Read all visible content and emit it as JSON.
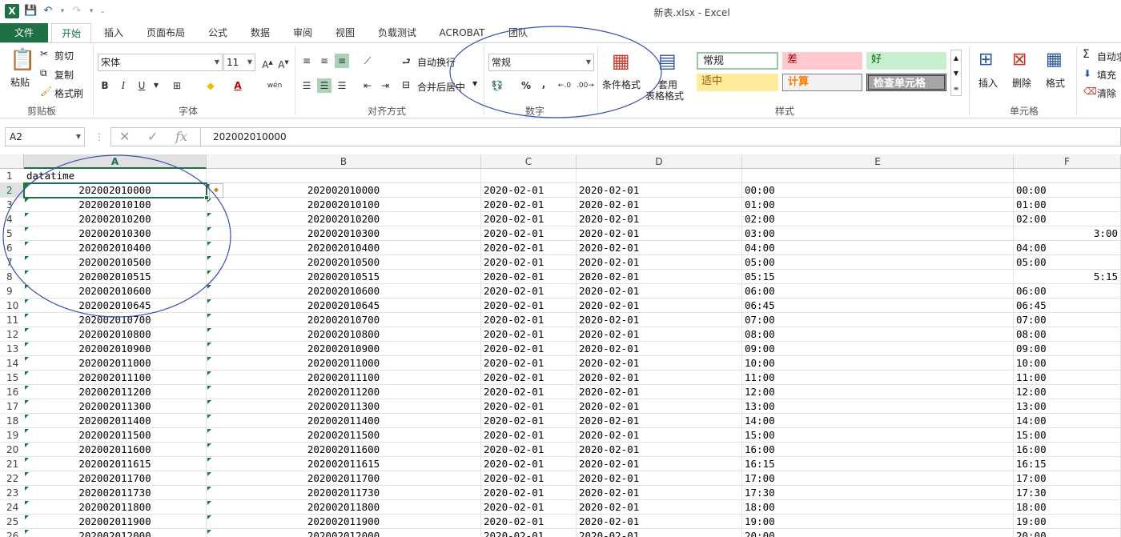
{
  "window": {
    "title": "新表.xlsx - Excel"
  },
  "tabs": [
    {
      "label": "文件"
    },
    {
      "label": "开始"
    },
    {
      "label": "插入"
    },
    {
      "label": "页面布局"
    },
    {
      "label": "公式"
    },
    {
      "label": "数据"
    },
    {
      "label": "审阅"
    },
    {
      "label": "视图"
    },
    {
      "label": "负载测试"
    },
    {
      "label": "ACROBAT"
    },
    {
      "label": "团队"
    }
  ],
  "ribbon": {
    "clipboard": {
      "paste": "粘贴",
      "cut": "剪切",
      "copy": "复制",
      "format_painter": "格式刷",
      "label": "剪贴板"
    },
    "font": {
      "name": "宋体",
      "size": "11",
      "bold": "B",
      "italic": "I",
      "underline": "U",
      "phonetic": "wén",
      "label": "字体"
    },
    "alignment": {
      "wrap": "自动换行",
      "merge": "合并后居中",
      "label": "对齐方式"
    },
    "number": {
      "format": "常规",
      "percent": "%",
      "comma": ",",
      "label": "数字"
    },
    "styles": {
      "conditional": "条件格式",
      "table_line1": "套用",
      "table_line2": "表格格式",
      "label": "样式",
      "cells": [
        {
          "text": "常规",
          "bg": "#ffffff",
          "fg": "#000000"
        },
        {
          "text": "差",
          "bg": "#ffc7ce",
          "fg": "#9c0006"
        },
        {
          "text": "好",
          "bg": "#c6efce",
          "fg": "#006100"
        },
        {
          "text": "适中",
          "bg": "#ffeb9c",
          "fg": "#9c5700"
        },
        {
          "text": "计算",
          "bg": "#f2f2f2",
          "fg": "#fa7d00"
        },
        {
          "text": "检查单元格",
          "bg": "#a5a5a5",
          "fg": "#ffffff"
        }
      ]
    },
    "cells": {
      "insert": "插入",
      "delete": "删除",
      "format": "格式",
      "label": "单元格"
    },
    "editing": {
      "autosum": "自动求",
      "fill": "填充",
      "clear": "清除"
    }
  },
  "formula_bar": {
    "name_box": "A2",
    "value": "202002010000"
  },
  "columns": [
    "A",
    "B",
    "C",
    "D",
    "E",
    "F"
  ],
  "rows": [
    {
      "n": "1",
      "a": "datatime",
      "b": "",
      "c": "",
      "d": "",
      "e": "",
      "f": "",
      "f_right": false
    },
    {
      "n": "2",
      "a": "202002010000",
      "b": "202002010000",
      "c": "2020-02-01",
      "d": "2020-02-01",
      "e": "00:00",
      "f": "00:00",
      "f_right": false
    },
    {
      "n": "3",
      "a": "202002010100",
      "b": "202002010100",
      "c": "2020-02-01",
      "d": "2020-02-01",
      "e": "01:00",
      "f": "01:00",
      "f_right": false
    },
    {
      "n": "4",
      "a": "202002010200",
      "b": "202002010200",
      "c": "2020-02-01",
      "d": "2020-02-01",
      "e": "02:00",
      "f": "02:00",
      "f_right": false
    },
    {
      "n": "5",
      "a": "202002010300",
      "b": "202002010300",
      "c": "2020-02-01",
      "d": "2020-02-01",
      "e": "03:00",
      "f": "3:00",
      "f_right": true
    },
    {
      "n": "6",
      "a": "202002010400",
      "b": "202002010400",
      "c": "2020-02-01",
      "d": "2020-02-01",
      "e": "04:00",
      "f": "04:00",
      "f_right": false
    },
    {
      "n": "7",
      "a": "202002010500",
      "b": "202002010500",
      "c": "2020-02-01",
      "d": "2020-02-01",
      "e": "05:00",
      "f": "05:00",
      "f_right": false
    },
    {
      "n": "8",
      "a": "202002010515",
      "b": "202002010515",
      "c": "2020-02-01",
      "d": "2020-02-01",
      "e": "05:15",
      "f": "5:15",
      "f_right": true
    },
    {
      "n": "9",
      "a": "202002010600",
      "b": "202002010600",
      "c": "2020-02-01",
      "d": "2020-02-01",
      "e": "06:00",
      "f": "06:00",
      "f_right": false
    },
    {
      "n": "10",
      "a": "202002010645",
      "b": "202002010645",
      "c": "2020-02-01",
      "d": "2020-02-01",
      "e": "06:45",
      "f": "06:45",
      "f_right": false
    },
    {
      "n": "11",
      "a": "202002010700",
      "b": "202002010700",
      "c": "2020-02-01",
      "d": "2020-02-01",
      "e": "07:00",
      "f": "07:00",
      "f_right": false
    },
    {
      "n": "12",
      "a": "202002010800",
      "b": "202002010800",
      "c": "2020-02-01",
      "d": "2020-02-01",
      "e": "08:00",
      "f": "08:00",
      "f_right": false
    },
    {
      "n": "13",
      "a": "202002010900",
      "b": "202002010900",
      "c": "2020-02-01",
      "d": "2020-02-01",
      "e": "09:00",
      "f": "09:00",
      "f_right": false
    },
    {
      "n": "14",
      "a": "202002011000",
      "b": "202002011000",
      "c": "2020-02-01",
      "d": "2020-02-01",
      "e": "10:00",
      "f": "10:00",
      "f_right": false
    },
    {
      "n": "15",
      "a": "202002011100",
      "b": "202002011100",
      "c": "2020-02-01",
      "d": "2020-02-01",
      "e": "11:00",
      "f": "11:00",
      "f_right": false
    },
    {
      "n": "16",
      "a": "202002011200",
      "b": "202002011200",
      "c": "2020-02-01",
      "d": "2020-02-01",
      "e": "12:00",
      "f": "12:00",
      "f_right": false
    },
    {
      "n": "17",
      "a": "202002011300",
      "b": "202002011300",
      "c": "2020-02-01",
      "d": "2020-02-01",
      "e": "13:00",
      "f": "13:00",
      "f_right": false
    },
    {
      "n": "18",
      "a": "202002011400",
      "b": "202002011400",
      "c": "2020-02-01",
      "d": "2020-02-01",
      "e": "14:00",
      "f": "14:00",
      "f_right": false
    },
    {
      "n": "19",
      "a": "202002011500",
      "b": "202002011500",
      "c": "2020-02-01",
      "d": "2020-02-01",
      "e": "15:00",
      "f": "15:00",
      "f_right": false
    },
    {
      "n": "20",
      "a": "202002011600",
      "b": "202002011600",
      "c": "2020-02-01",
      "d": "2020-02-01",
      "e": "16:00",
      "f": "16:00",
      "f_right": false
    },
    {
      "n": "21",
      "a": "202002011615",
      "b": "202002011615",
      "c": "2020-02-01",
      "d": "2020-02-01",
      "e": "16:15",
      "f": "16:15",
      "f_right": false
    },
    {
      "n": "22",
      "a": "202002011700",
      "b": "202002011700",
      "c": "2020-02-01",
      "d": "2020-02-01",
      "e": "17:00",
      "f": "17:00",
      "f_right": false
    },
    {
      "n": "23",
      "a": "202002011730",
      "b": "202002011730",
      "c": "2020-02-01",
      "d": "2020-02-01",
      "e": "17:30",
      "f": "17:30",
      "f_right": false
    },
    {
      "n": "24",
      "a": "202002011800",
      "b": "202002011800",
      "c": "2020-02-01",
      "d": "2020-02-01",
      "e": "18:00",
      "f": "18:00",
      "f_right": false
    },
    {
      "n": "25",
      "a": "202002011900",
      "b": "202002011900",
      "c": "2020-02-01",
      "d": "2020-02-01",
      "e": "19:00",
      "f": "19:00",
      "f_right": false
    },
    {
      "n": "26",
      "a": "202002012000",
      "b": "202002012000",
      "c": "2020-02-01",
      "d": "2020-02-01",
      "e": "20:00",
      "f": "20:00",
      "f_right": false
    }
  ],
  "colors": {
    "excel_green": "#1e7145",
    "annotation_blue": "#3a4fb0"
  }
}
